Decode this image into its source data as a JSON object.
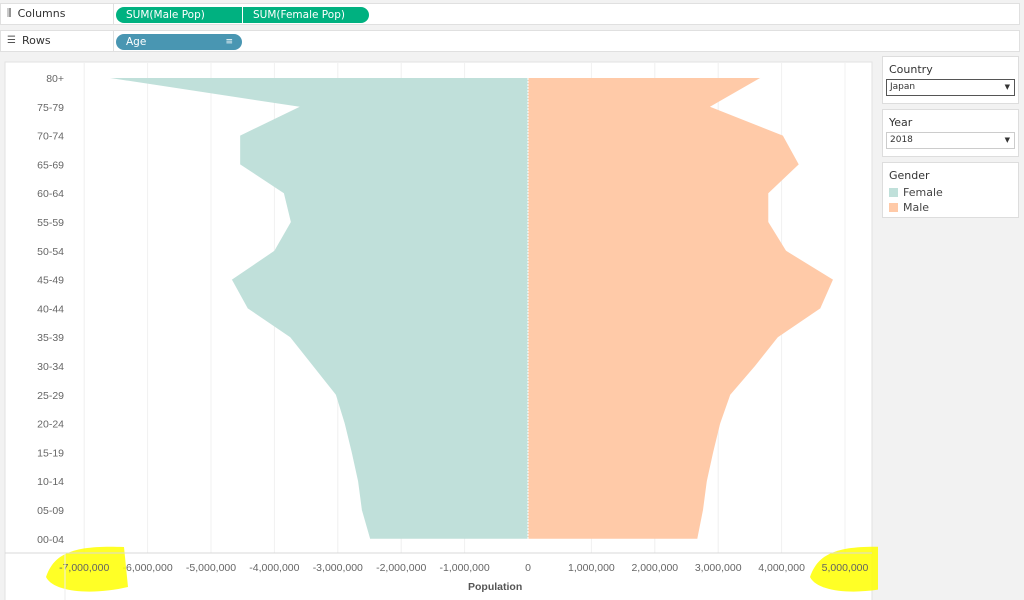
{
  "shelves": {
    "columns_label": "Columns",
    "rows_label": "Rows",
    "columns_icon": "columns-icon",
    "rows_icon": "rows-icon",
    "column_pills": [
      "SUM(Male Pop)",
      "SUM(Female Pop)"
    ],
    "row_pills": [
      "Age"
    ]
  },
  "filters": {
    "country": {
      "title": "Country",
      "value": "Japan"
    },
    "year": {
      "title": "Year",
      "value": "2018"
    }
  },
  "legend": {
    "title": "Gender",
    "items": [
      {
        "label": "Female",
        "color": "#c0e0da"
      },
      {
        "label": "Male",
        "color": "#ffcaa8"
      }
    ]
  },
  "colors": {
    "column_pill": "#00b180",
    "row_pill": "#4996b2",
    "highlight": "#ffff00"
  },
  "chart_data": {
    "type": "area",
    "orientation": "horizontal-pyramid",
    "xlabel": "Population",
    "xlim": [
      -7400000,
      5400000
    ],
    "x_ticks": [
      -7000000,
      -6000000,
      -5000000,
      -4000000,
      -3000000,
      -2000000,
      -1000000,
      0,
      1000000,
      2000000,
      3000000,
      4000000,
      5000000
    ],
    "x_tick_labels": [
      "-7,000,000",
      "-6,000,000",
      "-5,000,000",
      "-4,000,000",
      "-3,000,000",
      "-2,000,000",
      "-1,000,000",
      "0",
      "1,000,000",
      "2,000,000",
      "3,000,000",
      "4,000,000",
      "5,000,000"
    ],
    "categories": [
      "80+",
      "75-79",
      "70-74",
      "65-69",
      "60-64",
      "55-59",
      "50-54",
      "45-49",
      "40-44",
      "35-39",
      "30-34",
      "25-29",
      "20-24",
      "15-19",
      "10-14",
      "05-09",
      "00-04"
    ],
    "series": [
      {
        "name": "Female",
        "color": "#c0e0da",
        "values": [
          -6590000,
          -3600000,
          -4540000,
          -4540000,
          -3850000,
          -3740000,
          -4000000,
          -4670000,
          -4420000,
          -3750000,
          -3390000,
          -3030000,
          -2890000,
          -2780000,
          -2680000,
          -2620000,
          -2490000
        ]
      },
      {
        "name": "Male",
        "color": "#ffcaa8",
        "values": [
          3660000,
          2870000,
          4020000,
          4270000,
          3790000,
          3790000,
          4070000,
          4810000,
          4610000,
          3940000,
          3580000,
          3190000,
          3030000,
          2920000,
          2820000,
          2760000,
          2670000
        ]
      }
    ],
    "annotations": [
      "yellow highlight over -7,000,000 and 5,000,000 tick labels"
    ]
  }
}
